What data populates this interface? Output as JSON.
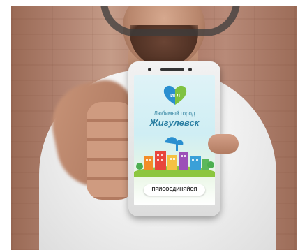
{
  "app": {
    "subtitle": "Любимый город",
    "title": "Жигулевск",
    "join_button": "ПРИСОЕДИНЯЙСЯ",
    "logo_text": "ИГЛ"
  },
  "icons": [
    "heart-logo-icon",
    "city-illustration-icon"
  ],
  "colors": {
    "title": "#2b7fa3",
    "logo_blue": "#2a8fd0",
    "logo_green": "#7fc241",
    "screen_sky": "#dff3f7"
  }
}
